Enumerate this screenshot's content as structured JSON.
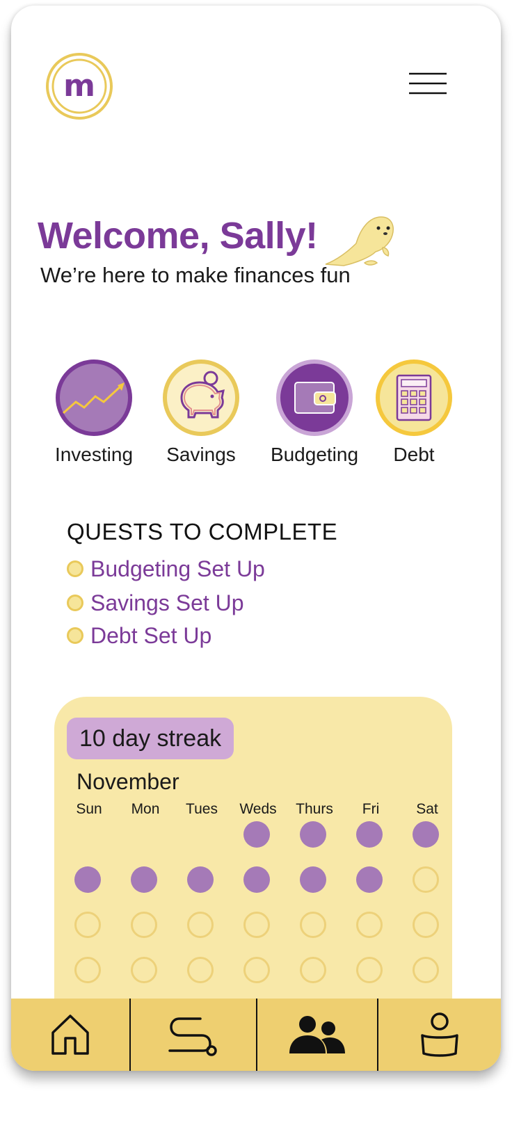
{
  "app": {
    "logo_letter": "m",
    "accent": "#7b3a98",
    "gold": "#eecf70"
  },
  "header": {
    "menu_icon": "hamburger-menu-icon"
  },
  "welcome": {
    "title": "Welcome, Sally!",
    "subtitle": "We’re here to make finances fun",
    "mascot": "baby-seal-illustration"
  },
  "categories": [
    {
      "label": "Investing",
      "icon": "chart-trend-up-icon"
    },
    {
      "label": "Savings",
      "icon": "piggy-bank-icon"
    },
    {
      "label": "Budgeting",
      "icon": "wallet-icon"
    },
    {
      "label": "Debt",
      "icon": "calculator-icon"
    }
  ],
  "quests": {
    "title": "QUESTS TO COMPLETE",
    "items": [
      {
        "label": "Budgeting Set Up"
      },
      {
        "label": "Savings Set Up"
      },
      {
        "label": "Debt Set Up"
      }
    ]
  },
  "streak": {
    "badge": "10 day streak",
    "month": "November",
    "days_of_week": [
      "Sun",
      "Mon",
      "Tues",
      "Weds",
      "Thurs",
      "Fri",
      "Sat"
    ],
    "weeks": [
      [
        null,
        null,
        null,
        "done",
        "done",
        "done",
        "done"
      ],
      [
        "done",
        "done",
        "done",
        "done",
        "done",
        "done",
        "todo"
      ],
      [
        "todo",
        "todo",
        "todo",
        "todo",
        "todo",
        "todo",
        "todo"
      ],
      [
        "todo",
        "todo",
        "todo",
        "todo",
        "todo",
        "todo",
        "todo"
      ]
    ]
  },
  "nav": {
    "items": [
      {
        "icon": "home-icon"
      },
      {
        "icon": "path-route-icon"
      },
      {
        "icon": "community-people-icon"
      },
      {
        "icon": "profile-icon"
      }
    ]
  }
}
